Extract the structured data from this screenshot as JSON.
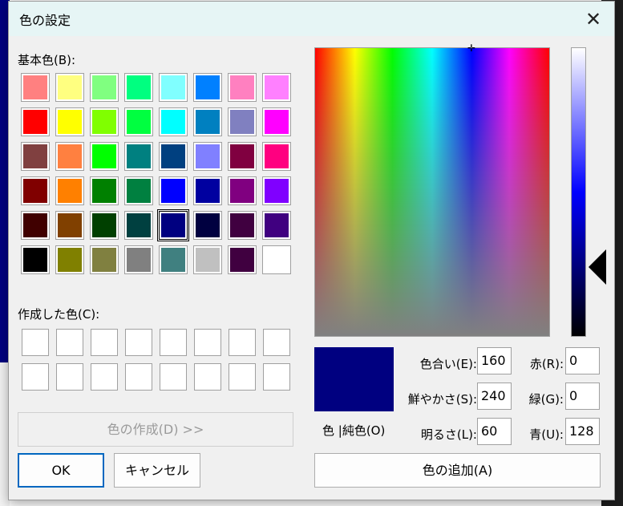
{
  "dialog": {
    "title": "色の設定",
    "close_label": "✕"
  },
  "basic_colors": {
    "label": "基本色(B):",
    "rows": [
      [
        "#ff8080",
        "#ffff80",
        "#80ff80",
        "#00ff80",
        "#80ffff",
        "#0080ff",
        "#ff80c0",
        "#ff80ff"
      ],
      [
        "#ff0000",
        "#ffff00",
        "#80ff00",
        "#00ff40",
        "#00ffff",
        "#0080c0",
        "#8080c0",
        "#ff00ff"
      ],
      [
        "#804040",
        "#ff8040",
        "#00ff00",
        "#008080",
        "#004080",
        "#8080ff",
        "#800040",
        "#ff0080"
      ],
      [
        "#800000",
        "#ff8000",
        "#008000",
        "#008040",
        "#0000ff",
        "#0000a0",
        "#800080",
        "#8000ff"
      ],
      [
        "#400000",
        "#804000",
        "#004000",
        "#004040",
        "#000080",
        "#000040",
        "#400040",
        "#400080"
      ],
      [
        "#000000",
        "#808000",
        "#808040",
        "#808080",
        "#408080",
        "#c0c0c0",
        "#400040",
        "#ffffff"
      ]
    ]
  },
  "custom_colors": {
    "label": "作成した色(C):",
    "count": 16
  },
  "buttons": {
    "define_custom": "色の作成(D) >>",
    "ok": "OK",
    "cancel": "キャンセル",
    "add_to_custom": "色の追加(A)"
  },
  "preview": {
    "color": "#000080",
    "label": "色 |純色(O)"
  },
  "fields": {
    "hue_label": "色合い(E):",
    "hue": "160",
    "sat_label": "鮮やかさ(S):",
    "sat": "240",
    "lum_label": "明るさ(L):",
    "lum": "60",
    "red_label": "赤(R):",
    "red": "0",
    "green_label": "緑(G):",
    "green": "0",
    "blue_label": "青(U):",
    "blue": "128"
  }
}
